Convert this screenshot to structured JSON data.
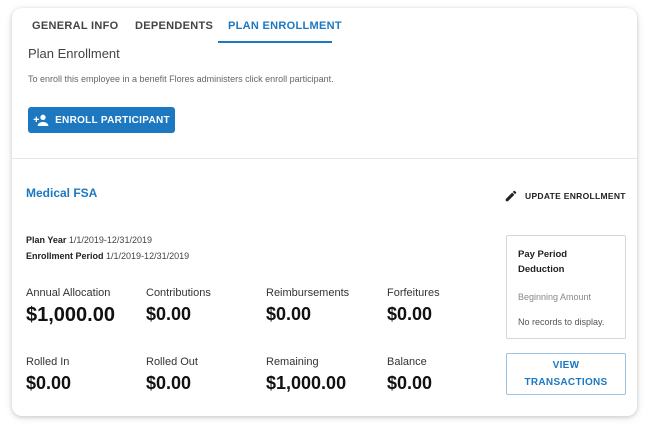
{
  "tabs": [
    {
      "label": "GENERAL INFO"
    },
    {
      "label": "DEPENDENTS"
    },
    {
      "label": "PLAN ENROLLMENT",
      "active": true
    }
  ],
  "enrollment": {
    "title": "Plan Enrollment",
    "description": "To enroll this employee in a benefit Flores administers click enroll participant.",
    "enroll_button": "ENROLL PARTICIPANT"
  },
  "plan": {
    "name": "Medical FSA",
    "update_button": "UPDATE ENROLLMENT",
    "plan_year_label": "Plan Year",
    "plan_year_value": "1/1/2019-12/31/2019",
    "enrollment_period_label": "Enrollment Period",
    "enrollment_period_value": "1/1/2019-12/31/2019",
    "stats": [
      {
        "label": "Annual Allocation",
        "value": "$1,000.00"
      },
      {
        "label": "Contributions",
        "value": "$0.00"
      },
      {
        "label": "Reimbursements",
        "value": "$0.00"
      },
      {
        "label": "Forfeitures",
        "value": "$0.00"
      },
      {
        "label": "Rolled In",
        "value": "$0.00"
      },
      {
        "label": "Rolled Out",
        "value": "$0.00"
      },
      {
        "label": "Remaining",
        "value": "$1,000.00"
      },
      {
        "label": "Balance",
        "value": "$0.00"
      }
    ],
    "pay_period": {
      "title": "Pay Period Deduction",
      "beginning_label": "Beginning Amount",
      "empty_text": "No records to display."
    },
    "view_button_line1": "VIEW",
    "view_button_line2": "TRANSACTIONS"
  },
  "colors": {
    "primary": "#1c78c0"
  }
}
